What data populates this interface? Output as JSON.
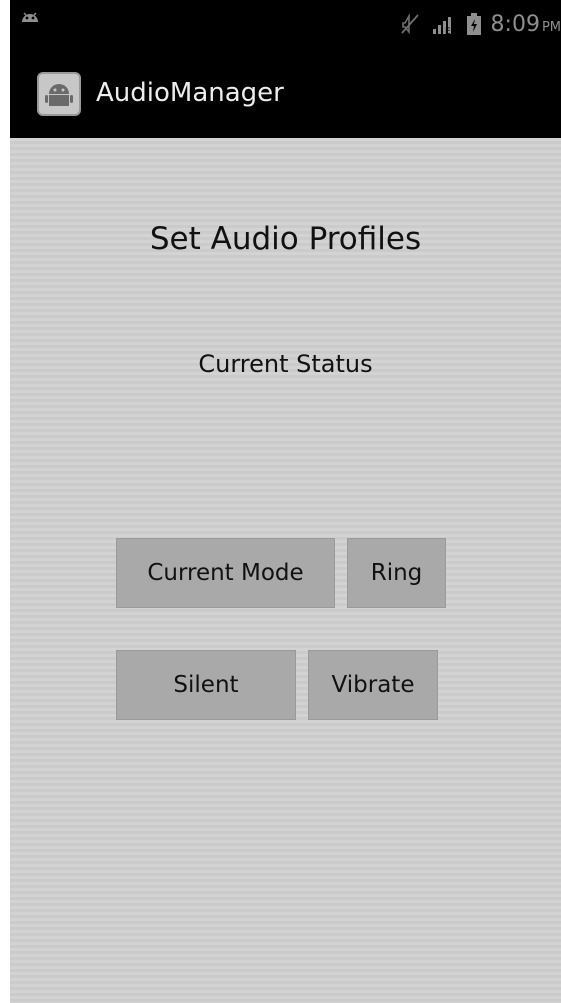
{
  "status_bar": {
    "time": "8:09",
    "ampm": "PM",
    "icons": [
      "android-notification-icon",
      "no-sound-icon",
      "signal-icon",
      "battery-icon"
    ]
  },
  "action_bar": {
    "title": "AudioManager",
    "icon": "android-app-icon"
  },
  "main": {
    "title": "Set Audio Profiles",
    "status_label": "Current Status"
  },
  "buttons": {
    "current_mode": "Current Mode",
    "ring": "Ring",
    "silent": "Silent",
    "vibrate": "Vibrate"
  },
  "colors": {
    "background": "#cfcfcf",
    "button": "#a9a9a9",
    "bar": "#000000"
  }
}
